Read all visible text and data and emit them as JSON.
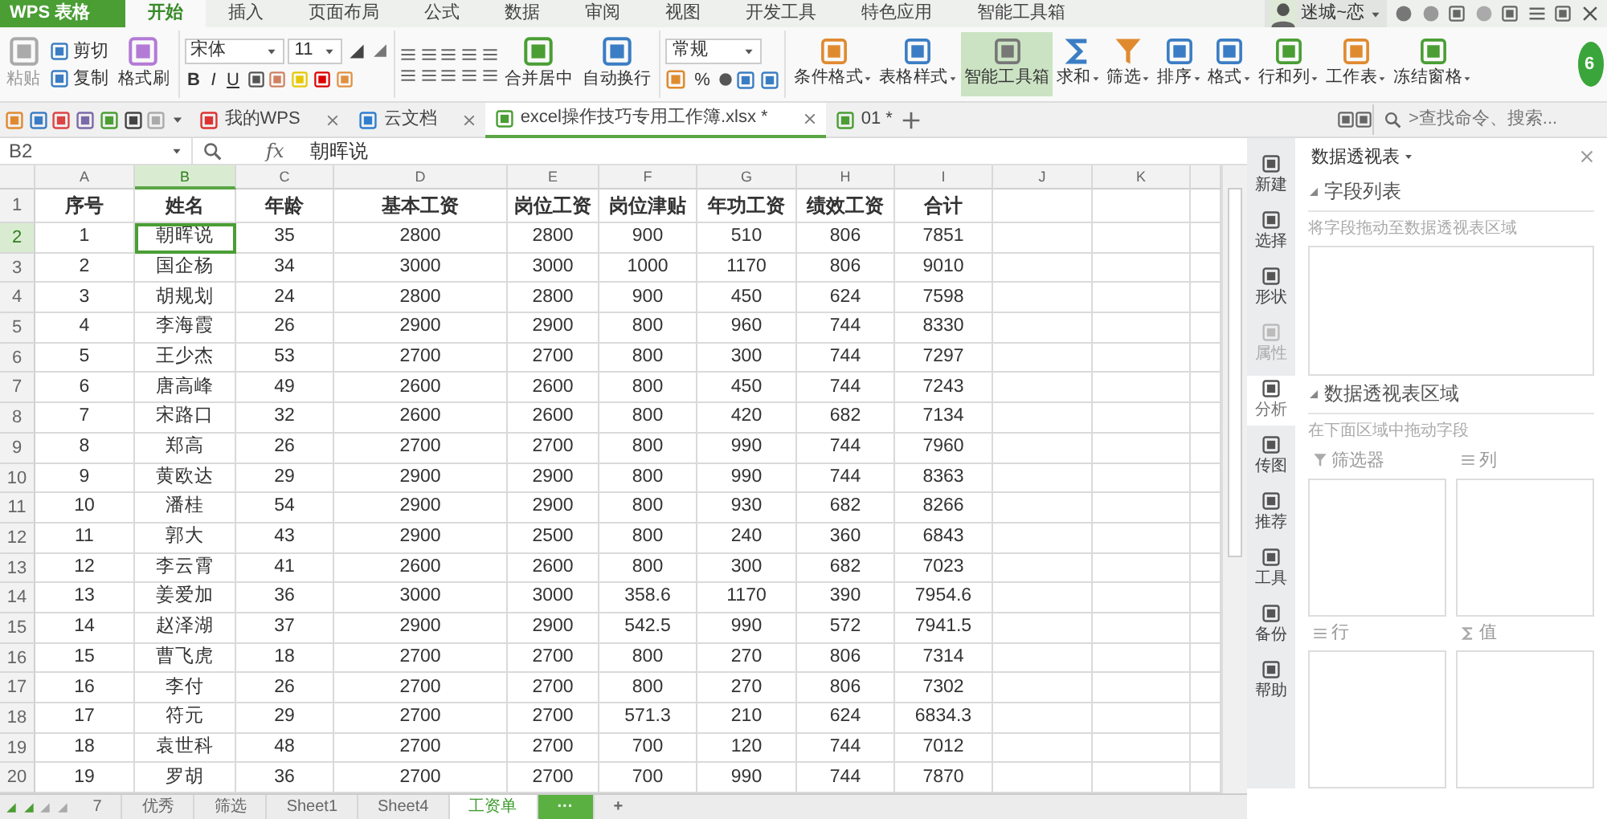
{
  "app_button": {
    "label": "WPS 表格"
  },
  "menu_tabs": [
    {
      "label": "开始",
      "selected": true
    },
    {
      "label": "插入",
      "selected": false
    },
    {
      "label": "页面布局",
      "selected": false
    },
    {
      "label": "公式",
      "selected": false
    },
    {
      "label": "数据",
      "selected": false
    },
    {
      "label": "审阅",
      "selected": false
    },
    {
      "label": "视图",
      "selected": false
    },
    {
      "label": "开发工具",
      "selected": false
    },
    {
      "label": "特色应用",
      "selected": false
    },
    {
      "label": "智能工具箱",
      "selected": false
    }
  ],
  "user": {
    "name": "迷城~恋"
  },
  "ribbon": {
    "paste": "粘贴",
    "cut": "剪切",
    "copy": "复制",
    "format_painter": "格式刷",
    "font_name": "宋体",
    "font_size": "11",
    "bold": "B",
    "italic": "I",
    "underline": "U",
    "merge": "合并居中",
    "wrap": "自动换行",
    "number_format": "常规",
    "percent": "%",
    "big_buttons": [
      {
        "label": "条件格式",
        "dropdown": true,
        "selected": false
      },
      {
        "label": "表格样式",
        "dropdown": true,
        "selected": false
      },
      {
        "label": "智能工具箱",
        "dropdown": false,
        "selected": true
      },
      {
        "label": "求和",
        "dropdown": true,
        "selected": false
      },
      {
        "label": "筛选",
        "dropdown": true,
        "selected": false
      },
      {
        "label": "排序",
        "dropdown": true,
        "selected": false
      },
      {
        "label": "格式",
        "dropdown": true,
        "selected": false
      },
      {
        "label": "行和列",
        "dropdown": true,
        "selected": false
      },
      {
        "label": "工作表",
        "dropdown": true,
        "selected": false
      },
      {
        "label": "冻结窗格",
        "dropdown": true,
        "selected": false
      }
    ]
  },
  "badge": {
    "text": "6"
  },
  "doc_tabs": [
    {
      "label": "我的WPS",
      "selected": false
    },
    {
      "label": "云文档",
      "selected": false
    },
    {
      "label": "excel操作技巧专用工作簿.xlsx *",
      "selected": true
    },
    {
      "label": "01 *",
      "selected": false
    }
  ],
  "search": {
    "placeholder": ">查找命令、搜索..."
  },
  "formula_bar": {
    "cell_ref": "B2",
    "fx": "fx",
    "value": "朝晖说"
  },
  "sheet": {
    "columns": [
      {
        "letter": "A",
        "selected": false
      },
      {
        "letter": "B",
        "selected": true
      },
      {
        "letter": "C",
        "selected": false
      },
      {
        "letter": "D",
        "selected": false
      },
      {
        "letter": "E",
        "selected": false
      },
      {
        "letter": "F",
        "selected": false
      },
      {
        "letter": "G",
        "selected": false
      },
      {
        "letter": "H",
        "selected": false
      },
      {
        "letter": "I",
        "selected": false
      },
      {
        "letter": "J",
        "selected": false
      },
      {
        "letter": "K",
        "selected": false
      }
    ],
    "rows": [
      {
        "num": "1",
        "kind": "header",
        "selected": false,
        "cells": [
          "序号",
          "姓名",
          "年龄",
          "基本工资",
          "岗位工资",
          "岗位津贴",
          "年功工资",
          "绩效工资",
          "合计"
        ]
      },
      {
        "num": "2",
        "kind": "data",
        "selected": true,
        "cells": [
          "1",
          "朝晖说",
          "35",
          "2800",
          "2800",
          "900",
          "510",
          "806",
          "7851"
        ]
      },
      {
        "num": "3",
        "kind": "data",
        "selected": false,
        "cells": [
          "2",
          "国企杨",
          "34",
          "3000",
          "3000",
          "1000",
          "1170",
          "806",
          "9010"
        ]
      },
      {
        "num": "4",
        "kind": "data",
        "selected": false,
        "cells": [
          "3",
          "胡规划",
          "24",
          "2800",
          "2800",
          "900",
          "450",
          "624",
          "7598"
        ]
      },
      {
        "num": "5",
        "kind": "data",
        "selected": false,
        "cells": [
          "4",
          "李海霞",
          "26",
          "2900",
          "2900",
          "800",
          "960",
          "744",
          "8330"
        ]
      },
      {
        "num": "6",
        "kind": "data",
        "selected": false,
        "cells": [
          "5",
          "王少杰",
          "53",
          "2700",
          "2700",
          "800",
          "300",
          "744",
          "7297"
        ]
      },
      {
        "num": "7",
        "kind": "data",
        "selected": false,
        "cells": [
          "6",
          "唐高峰",
          "49",
          "2600",
          "2600",
          "800",
          "450",
          "744",
          "7243"
        ]
      },
      {
        "num": "8",
        "kind": "data",
        "selected": false,
        "cells": [
          "7",
          "宋路口",
          "32",
          "2600",
          "2600",
          "800",
          "420",
          "682",
          "7134"
        ]
      },
      {
        "num": "9",
        "kind": "data",
        "selected": false,
        "cells": [
          "8",
          "郑高",
          "26",
          "2700",
          "2700",
          "800",
          "990",
          "744",
          "7960"
        ]
      },
      {
        "num": "10",
        "kind": "data",
        "selected": false,
        "cells": [
          "9",
          "黄欧达",
          "29",
          "2900",
          "2900",
          "800",
          "990",
          "744",
          "8363"
        ]
      },
      {
        "num": "11",
        "kind": "data",
        "selected": false,
        "cells": [
          "10",
          "潘桂",
          "54",
          "2900",
          "2900",
          "800",
          "930",
          "682",
          "8266"
        ]
      },
      {
        "num": "12",
        "kind": "data",
        "selected": false,
        "cells": [
          "11",
          "郭大",
          "43",
          "2900",
          "2500",
          "800",
          "240",
          "360",
          "6843"
        ]
      },
      {
        "num": "13",
        "kind": "data",
        "selected": false,
        "cells": [
          "12",
          "李云霄",
          "41",
          "2600",
          "2600",
          "800",
          "300",
          "682",
          "7023"
        ]
      },
      {
        "num": "14",
        "kind": "data",
        "selected": false,
        "cells": [
          "13",
          "姜爱加",
          "36",
          "3000",
          "3000",
          "358.6",
          "1170",
          "390",
          "7954.6"
        ]
      },
      {
        "num": "15",
        "kind": "data",
        "selected": false,
        "cells": [
          "14",
          "赵泽湖",
          "37",
          "2900",
          "2900",
          "542.5",
          "990",
          "572",
          "7941.5"
        ]
      },
      {
        "num": "16",
        "kind": "data",
        "selected": false,
        "cells": [
          "15",
          "曹飞虎",
          "18",
          "2700",
          "2700",
          "800",
          "270",
          "806",
          "7314"
        ]
      },
      {
        "num": "17",
        "kind": "data",
        "selected": false,
        "cells": [
          "16",
          "李付",
          "26",
          "2700",
          "2700",
          "800",
          "270",
          "806",
          "7302"
        ]
      },
      {
        "num": "18",
        "kind": "data",
        "selected": false,
        "cells": [
          "17",
          "符元",
          "29",
          "2700",
          "2700",
          "571.3",
          "210",
          "624",
          "6834.3"
        ]
      },
      {
        "num": "19",
        "kind": "data",
        "selected": false,
        "cells": [
          "18",
          "袁世科",
          "48",
          "2700",
          "2700",
          "700",
          "120",
          "744",
          "7012"
        ]
      },
      {
        "num": "20",
        "kind": "data",
        "selected": false,
        "cells": [
          "19",
          "罗胡",
          "36",
          "2700",
          "2700",
          "700",
          "990",
          "744",
          "7870"
        ]
      }
    ]
  },
  "sheet_tabs": [
    {
      "label": "7",
      "selected": false
    },
    {
      "label": "优秀",
      "selected": false
    },
    {
      "label": "筛选",
      "selected": false
    },
    {
      "label": "Sheet1",
      "selected": false
    },
    {
      "label": "Sheet4",
      "selected": false
    },
    {
      "label": "工资单",
      "selected": true
    }
  ],
  "sheet_tab_more": "···",
  "sheet_tab_add": "+",
  "side_tools": [
    {
      "label": "新建",
      "selected": false,
      "disabled": false
    },
    {
      "label": "选择",
      "selected": false,
      "disabled": false
    },
    {
      "label": "形状",
      "selected": false,
      "disabled": false
    },
    {
      "label": "属性",
      "selected": false,
      "disabled": true
    },
    {
      "label": "分析",
      "selected": true,
      "disabled": false
    },
    {
      "label": "传图",
      "selected": false,
      "disabled": false
    },
    {
      "label": "推荐",
      "selected": false,
      "disabled": false
    },
    {
      "label": "工具",
      "selected": false,
      "disabled": false
    },
    {
      "label": "备份",
      "selected": false,
      "disabled": false
    },
    {
      "label": "帮助",
      "selected": false,
      "disabled": false
    }
  ],
  "panel": {
    "title": "数据透视表",
    "field_section": "字段列表",
    "field_hint": "将字段拖动至数据透视表区域",
    "area_section": "数据透视表区域",
    "area_hint": "在下面区域中拖动字段",
    "areas": [
      {
        "label": "筛选器"
      },
      {
        "label": "列"
      },
      {
        "label": "行"
      },
      {
        "label": "值"
      }
    ]
  }
}
